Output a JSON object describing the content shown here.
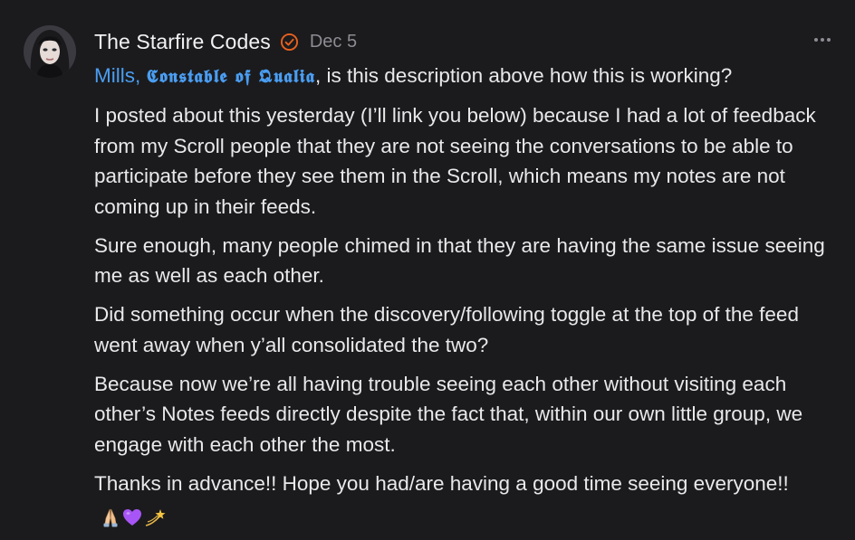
{
  "note": {
    "author": {
      "name": "The Starfire Codes",
      "avatar_icon": "user-avatar",
      "verified_icon": "verified-badge-icon",
      "verified_color": "#e8611f"
    },
    "timestamp": "Dec 5",
    "more_icon": "more-horizontal-icon",
    "mention": {
      "prefix": "Mills, ",
      "styled": "𝕮𝖔𝖓𝖘𝖙𝖆𝖇𝖑𝖊 𝖔𝖋 𝕼𝖚𝖆𝖑𝖎𝖆",
      "color": "#4a9df1"
    },
    "mention_suffix": ", is this description above how this is working?",
    "paragraphs": [
      "I posted about this yesterday (I’ll link you below) because I had a lot of feedback from my Scroll people that they are not seeing the conversations to be able to participate before they see them in the Scroll, which means my notes are not coming up in their feeds.",
      "Sure enough, many people chimed in that they are having the same issue seeing me as well as each other.",
      "Did something occur when the discovery/following toggle at the top of the feed went away when y’all consolidated the two?",
      "Because now we’re all having trouble seeing each other without visiting each other’s Notes feeds directly despite the fact that, within our own little group, we engage with each other the most."
    ],
    "closing": "Thanks in advance!! Hope you had/are having a good time seeing everyone!!",
    "emojis": [
      "folded-hands-icon",
      "purple-heart-icon",
      "dizzy-star-icon"
    ]
  }
}
